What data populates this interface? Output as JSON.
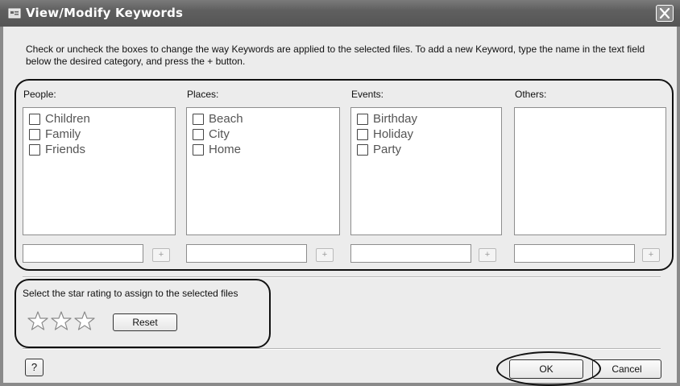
{
  "window": {
    "title": "View/Modify Keywords",
    "close_icon": "close-icon"
  },
  "instructions": "Check or uncheck the boxes to change the way Keywords are applied to the selected files. To add a new Keyword, type the name in the text field below the desired category, and press the + button.",
  "categories": [
    {
      "label": "People:",
      "items": [
        "Children",
        "Family",
        "Friends"
      ],
      "input_value": "",
      "add_label": "+"
    },
    {
      "label": "Places:",
      "items": [
        "Beach",
        "City",
        "Home"
      ],
      "input_value": "",
      "add_label": "+"
    },
    {
      "label": "Events:",
      "items": [
        "Birthday",
        "Holiday",
        "Party"
      ],
      "input_value": "",
      "add_label": "+"
    },
    {
      "label": "Others:",
      "items": [],
      "input_value": "",
      "add_label": "+"
    }
  ],
  "rating": {
    "label": "Select the star rating to assign to the selected files",
    "stars": 3,
    "selected": 0,
    "reset_label": "Reset"
  },
  "footer": {
    "help_label": "?",
    "ok_label": "OK",
    "cancel_label": "Cancel"
  }
}
